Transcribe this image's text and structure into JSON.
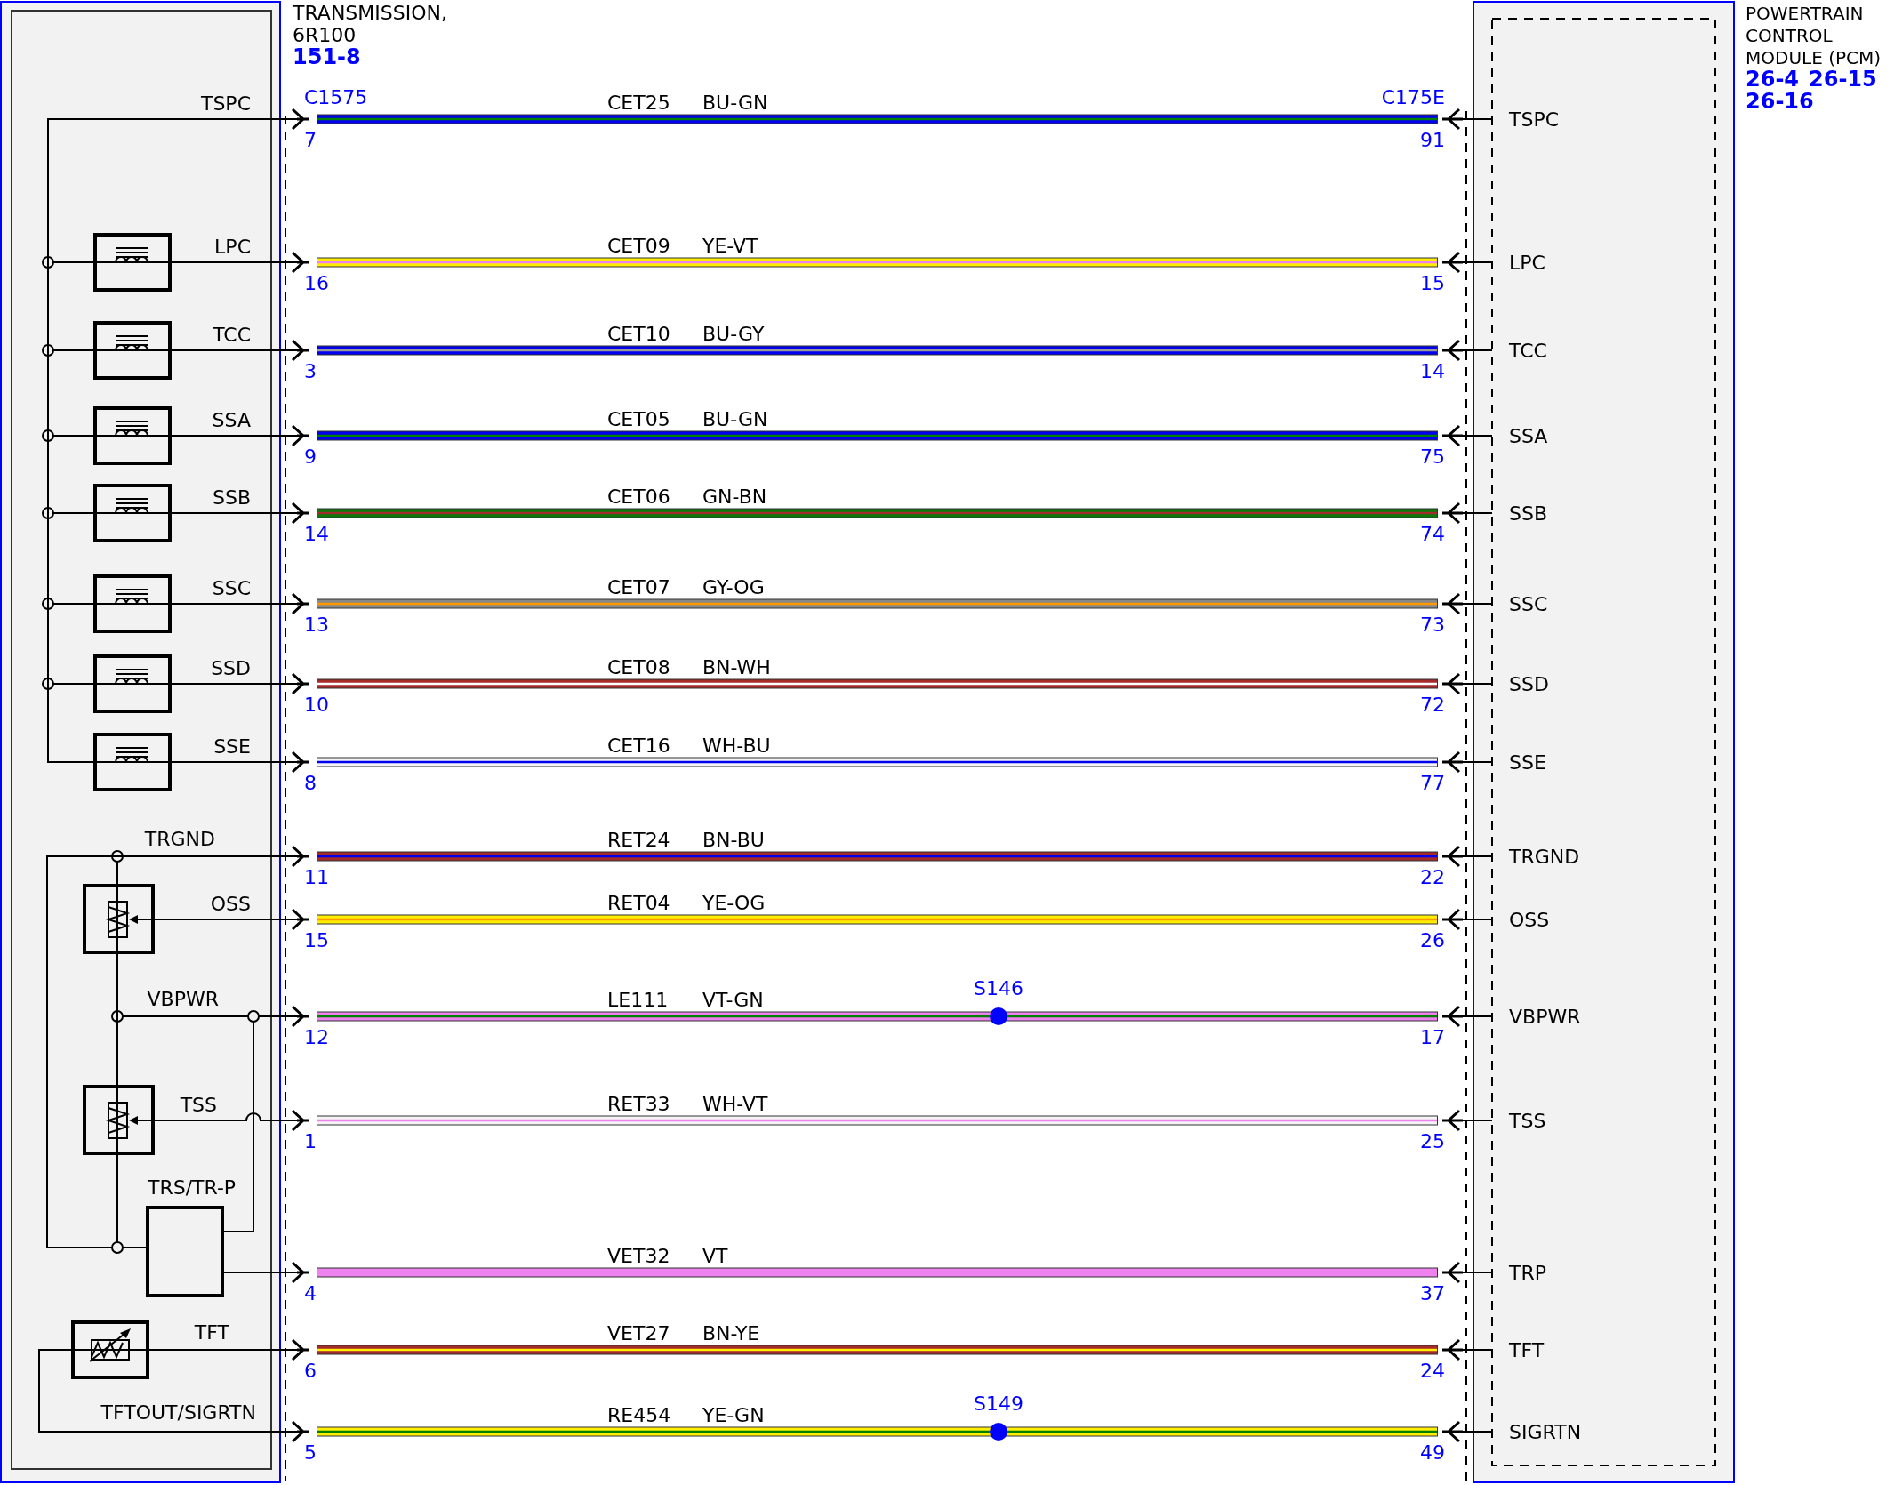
{
  "left_component": {
    "title_lines": [
      "TRANSMISSION,",
      "6R100"
    ],
    "page_ref": "151-8",
    "connector": "C1575"
  },
  "right_component": {
    "title_lines": [
      "POWERTRAIN",
      "CONTROL",
      "MODULE (PCM)"
    ],
    "page_refs": [
      "26-4",
      "26-15",
      "26-16"
    ],
    "connector": "C175E"
  },
  "circuits": [
    {
      "kind": "bus",
      "left_label": "TSPC",
      "left_pin": "7",
      "circuit": "CET25",
      "color_code": "BU-GN",
      "color": "#0000ee",
      "stripe": {
        "color": "#008000"
      },
      "right_pin": "91",
      "right_label": "TSPC"
    },
    {
      "kind": "solenoid",
      "left_label": "LPC",
      "left_pin": "16",
      "circuit": "CET09",
      "color_code": "YE-VT",
      "color": "#ffee00",
      "stripe": {
        "color": "#ee82ee"
      },
      "right_pin": "15",
      "right_label": "LPC"
    },
    {
      "kind": "solenoid",
      "left_label": "TCC",
      "left_pin": "3",
      "circuit": "CET10",
      "color_code": "BU-GY",
      "color": "#0000ee",
      "stripe": {
        "color": "#999999"
      },
      "right_pin": "14",
      "right_label": "TCC"
    },
    {
      "kind": "solenoid",
      "left_label": "SSA",
      "left_pin": "9",
      "circuit": "CET05",
      "color_code": "BU-GN",
      "color": "#0000ee",
      "stripe": {
        "color": "#008000"
      },
      "right_pin": "75",
      "right_label": "SSA"
    },
    {
      "kind": "solenoid",
      "left_label": "SSB",
      "left_pin": "14",
      "circuit": "CET06",
      "color_code": "GN-BN",
      "color": "#0a7a0a",
      "stripe": {
        "color": "#a52a2a"
      },
      "right_pin": "74",
      "right_label": "SSB"
    },
    {
      "kind": "solenoid",
      "left_label": "SSC",
      "left_pin": "13",
      "circuit": "CET07",
      "color_code": "GY-OG",
      "color": "#888888",
      "stripe": {
        "color": "#ff9900"
      },
      "right_pin": "73",
      "right_label": "SSC"
    },
    {
      "kind": "solenoid",
      "left_label": "SSD",
      "left_pin": "10",
      "circuit": "CET08",
      "color_code": "BN-WH",
      "color": "#a52a2a",
      "stripe": {
        "color": "#ffffff"
      },
      "right_pin": "72",
      "right_label": "SSD"
    },
    {
      "kind": "solenoid_end",
      "left_label": "SSE",
      "left_pin": "8",
      "circuit": "CET16",
      "color_code": "WH-BU",
      "color": "#f4f4f4",
      "stripe": {
        "color": "#0000ee"
      },
      "right_pin": "77",
      "right_label": "SSE"
    },
    {
      "kind": "ground",
      "left_label": "TRGND",
      "left_pin": "11",
      "circuit": "RET24",
      "color_code": "BN-BU",
      "color": "#a52a2a",
      "stripe": {
        "color": "#0000ee"
      },
      "right_pin": "22",
      "right_label": "TRGND"
    },
    {
      "kind": "sensor",
      "left_label": "OSS",
      "left_pin": "15",
      "circuit": "RET04",
      "color_code": "YE-OG",
      "color": "#ffee00",
      "stripe": {
        "color": "#ff9900"
      },
      "right_pin": "26",
      "right_label": "OSS"
    },
    {
      "kind": "power",
      "left_label": "VBPWR",
      "left_pin": "12",
      "circuit": "LE111",
      "color_code": "VT-GN",
      "color": "#ee82ee",
      "stripe": {
        "color": "#008000"
      },
      "splice": "S146",
      "right_pin": "17",
      "right_label": "VBPWR"
    },
    {
      "kind": "sensor_hop",
      "left_label": "TSS",
      "left_pin": "1",
      "circuit": "RET33",
      "color_code": "WH-VT",
      "color": "#f4f4f4",
      "stripe": {
        "color": "#ee82ee"
      },
      "right_pin": "25",
      "right_label": "TSS"
    },
    {
      "kind": "switch",
      "left_label": "TRS/TR-P",
      "left_pin": "4",
      "circuit": "VET32",
      "color_code": "VT",
      "color": "#ee82ee",
      "right_pin": "37",
      "right_label": "TRP"
    },
    {
      "kind": "thermistor",
      "left_label": "TFT",
      "left_pin": "6",
      "circuit": "VET27",
      "color_code": "BN-YE",
      "color": "#a52a2a",
      "stripe": {
        "color": "#ffee00"
      },
      "right_pin": "24",
      "right_label": "TFT"
    },
    {
      "kind": "return",
      "left_label": "TFTOUT/SIGRTN",
      "left_pin": "5",
      "circuit": "RE454",
      "color_code": "YE-GN",
      "color": "#ffee00",
      "stripe": {
        "color": "#008000"
      },
      "splice": "S149",
      "right_pin": "49",
      "right_label": "SIGRTN"
    }
  ]
}
